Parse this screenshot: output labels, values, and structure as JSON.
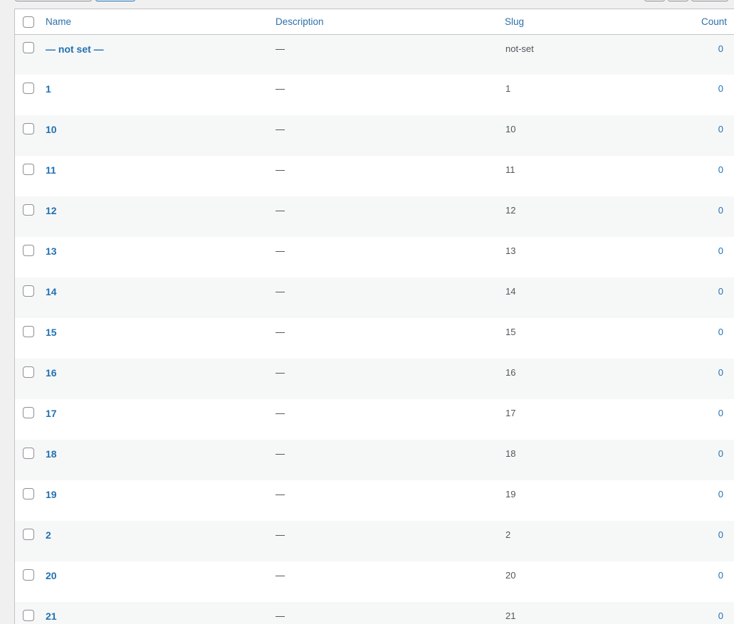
{
  "table": {
    "columns": {
      "name": "Name",
      "description": "Description",
      "slug": "Slug",
      "count": "Count"
    },
    "rows": [
      {
        "name": "— not set —",
        "description": "—",
        "slug": "not-set",
        "count": "0"
      },
      {
        "name": "1",
        "description": "—",
        "slug": "1",
        "count": "0"
      },
      {
        "name": "10",
        "description": "—",
        "slug": "10",
        "count": "0"
      },
      {
        "name": "11",
        "description": "—",
        "slug": "11",
        "count": "0"
      },
      {
        "name": "12",
        "description": "—",
        "slug": "12",
        "count": "0"
      },
      {
        "name": "13",
        "description": "—",
        "slug": "13",
        "count": "0"
      },
      {
        "name": "14",
        "description": "—",
        "slug": "14",
        "count": "0"
      },
      {
        "name": "15",
        "description": "—",
        "slug": "15",
        "count": "0"
      },
      {
        "name": "16",
        "description": "—",
        "slug": "16",
        "count": "0"
      },
      {
        "name": "17",
        "description": "—",
        "slug": "17",
        "count": "0"
      },
      {
        "name": "18",
        "description": "—",
        "slug": "18",
        "count": "0"
      },
      {
        "name": "19",
        "description": "—",
        "slug": "19",
        "count": "0"
      },
      {
        "name": "2",
        "description": "—",
        "slug": "2",
        "count": "0"
      },
      {
        "name": "20",
        "description": "—",
        "slug": "20",
        "count": "0"
      },
      {
        "name": "21",
        "description": "—",
        "slug": "21",
        "count": "0"
      }
    ]
  },
  "colors": {
    "link": "#2271b1",
    "header_text": "#2c70a8",
    "stripe": "#f6f7f7",
    "border": "#c3c4c7"
  }
}
